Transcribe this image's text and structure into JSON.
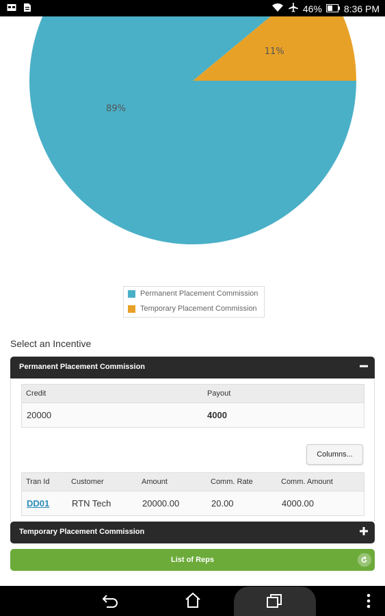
{
  "status_bar": {
    "battery": "46%",
    "time": "8:36 PM",
    "icons": [
      "notification-image-icon",
      "notification-doc-icon",
      "wifi-icon",
      "airplane-icon",
      "battery-icon"
    ]
  },
  "chart_data": {
    "type": "pie",
    "slices": [
      {
        "label": "Permanent Placement Commission",
        "value": 89,
        "display": "89%",
        "color": "#4ab0c7"
      },
      {
        "label": "Temporary Placement Commission",
        "value": 11,
        "display": "11%",
        "color": "#e8a127"
      }
    ]
  },
  "legend": {
    "items": [
      {
        "label": "Permanent Placement Commission",
        "color": "#4ab0c7"
      },
      {
        "label": "Temporary Placement Commission",
        "color": "#e8a127"
      }
    ]
  },
  "select_incentive_label": "Select an Incentive",
  "panels": {
    "permanent": {
      "title": "Permanent Placement Commission",
      "icon": "minus"
    },
    "temporary": {
      "title": "Temporary Placement Commission",
      "icon": "plus"
    }
  },
  "summary_table": {
    "headers": [
      "Credit",
      "Payout"
    ],
    "row": [
      "20000",
      "4000"
    ]
  },
  "columns_button": "Columns...",
  "transactions_table": {
    "headers": [
      "Tran Id",
      "Customer",
      "Amount",
      "Comm. Rate",
      "Comm. Amount"
    ],
    "rows": [
      [
        "DD01",
        "RTN Tech",
        "20000.00",
        "20.00",
        "4000.00"
      ]
    ]
  },
  "list_of_reps_button": "List of Reps",
  "colors": {
    "accent_blue": "#4ab0c7",
    "accent_orange": "#e8a127",
    "header_dark": "#2a2a2a",
    "button_green": "#6cab3a",
    "link": "#2a8bb8"
  }
}
